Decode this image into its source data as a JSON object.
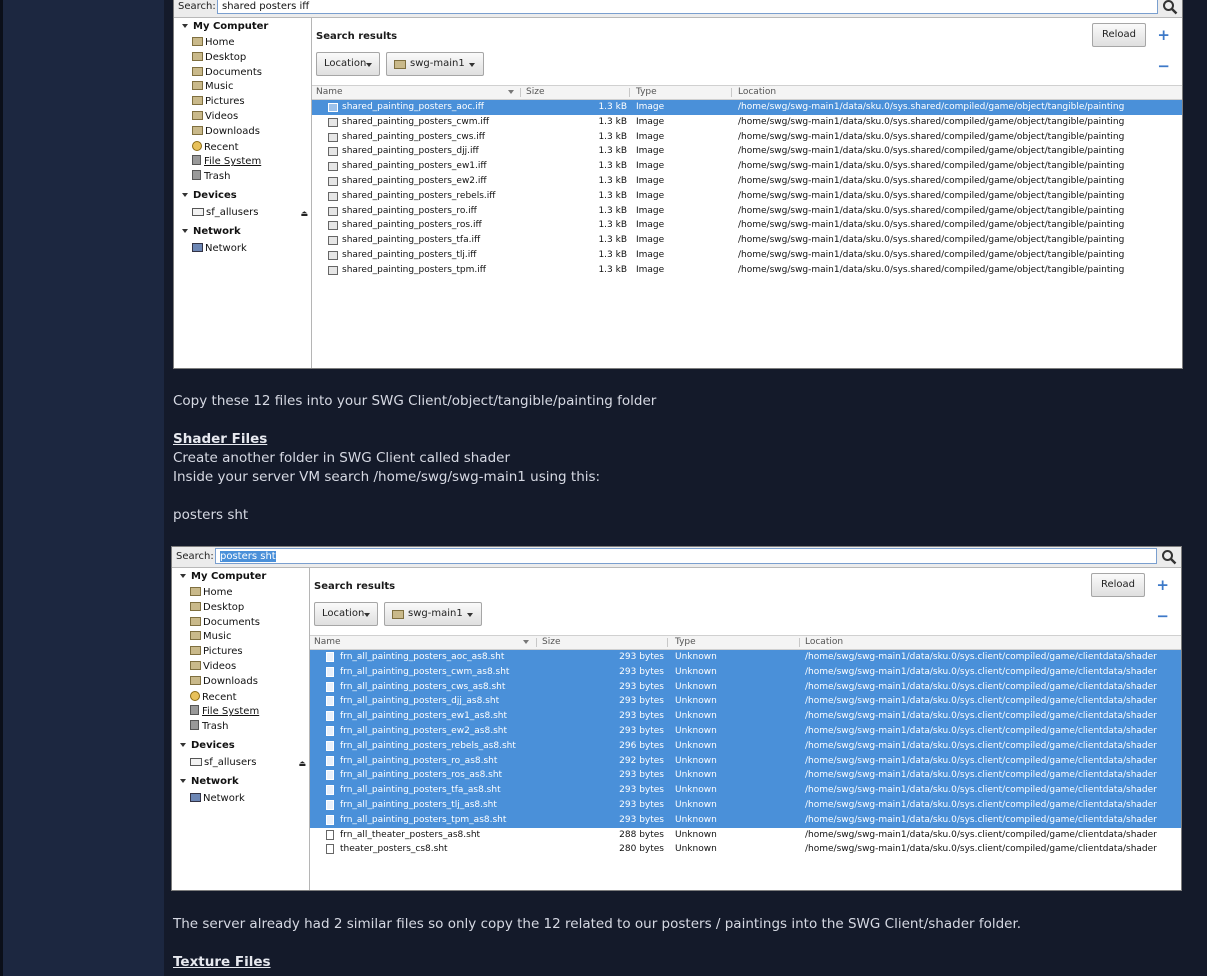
{
  "fm1": {
    "search_label": "Search:",
    "search_value": "shared posters iff",
    "places": {
      "my_computer": "My Computer",
      "items": [
        "Home",
        "Desktop",
        "Documents",
        "Music",
        "Pictures",
        "Videos",
        "Downloads",
        "Recent",
        "File System",
        "Trash"
      ],
      "devices": "Devices",
      "device_items": [
        "sf_allusers"
      ],
      "network": "Network",
      "network_items": [
        "Network"
      ]
    },
    "results_title": "Search results",
    "reload": "Reload",
    "location_btn": "Location",
    "folder_btn": "swg-main1",
    "columns": {
      "name": "Name",
      "size": "Size",
      "type": "Type",
      "location": "Location"
    },
    "rows": [
      {
        "name": "shared_painting_posters_aoc.iff",
        "size": "1.3 kB",
        "type": "Image",
        "location": "/home/swg/swg-main1/data/sku.0/sys.shared/compiled/game/object/tangible/painting",
        "selected": true
      },
      {
        "name": "shared_painting_posters_cwm.iff",
        "size": "1.3 kB",
        "type": "Image",
        "location": "/home/swg/swg-main1/data/sku.0/sys.shared/compiled/game/object/tangible/painting",
        "selected": false
      },
      {
        "name": "shared_painting_posters_cws.iff",
        "size": "1.3 kB",
        "type": "Image",
        "location": "/home/swg/swg-main1/data/sku.0/sys.shared/compiled/game/object/tangible/painting",
        "selected": false
      },
      {
        "name": "shared_painting_posters_djj.iff",
        "size": "1.3 kB",
        "type": "Image",
        "location": "/home/swg/swg-main1/data/sku.0/sys.shared/compiled/game/object/tangible/painting",
        "selected": false
      },
      {
        "name": "shared_painting_posters_ew1.iff",
        "size": "1.3 kB",
        "type": "Image",
        "location": "/home/swg/swg-main1/data/sku.0/sys.shared/compiled/game/object/tangible/painting",
        "selected": false
      },
      {
        "name": "shared_painting_posters_ew2.iff",
        "size": "1.3 kB",
        "type": "Image",
        "location": "/home/swg/swg-main1/data/sku.0/sys.shared/compiled/game/object/tangible/painting",
        "selected": false
      },
      {
        "name": "shared_painting_posters_rebels.iff",
        "size": "1.3 kB",
        "type": "Image",
        "location": "/home/swg/swg-main1/data/sku.0/sys.shared/compiled/game/object/tangible/painting",
        "selected": false
      },
      {
        "name": "shared_painting_posters_ro.iff",
        "size": "1.3 kB",
        "type": "Image",
        "location": "/home/swg/swg-main1/data/sku.0/sys.shared/compiled/game/object/tangible/painting",
        "selected": false
      },
      {
        "name": "shared_painting_posters_ros.iff",
        "size": "1.3 kB",
        "type": "Image",
        "location": "/home/swg/swg-main1/data/sku.0/sys.shared/compiled/game/object/tangible/painting",
        "selected": false
      },
      {
        "name": "shared_painting_posters_tfa.iff",
        "size": "1.3 kB",
        "type": "Image",
        "location": "/home/swg/swg-main1/data/sku.0/sys.shared/compiled/game/object/tangible/painting",
        "selected": false
      },
      {
        "name": "shared_painting_posters_tlj.iff",
        "size": "1.3 kB",
        "type": "Image",
        "location": "/home/swg/swg-main1/data/sku.0/sys.shared/compiled/game/object/tangible/painting",
        "selected": false
      },
      {
        "name": "shared_painting_posters_tpm.iff",
        "size": "1.3 kB",
        "type": "Image",
        "location": "/home/swg/swg-main1/data/sku.0/sys.shared/compiled/game/object/tangible/painting",
        "selected": false
      }
    ]
  },
  "fm2": {
    "search_label": "Search:",
    "search_value": "posters sht",
    "places": {
      "my_computer": "My Computer",
      "items": [
        "Home",
        "Desktop",
        "Documents",
        "Music",
        "Pictures",
        "Videos",
        "Downloads",
        "Recent",
        "File System",
        "Trash"
      ],
      "devices": "Devices",
      "device_items": [
        "sf_allusers"
      ],
      "network": "Network",
      "network_items": [
        "Network"
      ]
    },
    "results_title": "Search results",
    "reload": "Reload",
    "location_btn": "Location",
    "folder_btn": "swg-main1",
    "columns": {
      "name": "Name",
      "size": "Size",
      "type": "Type",
      "location": "Location"
    },
    "rows": [
      {
        "name": "frn_all_painting_posters_aoc_as8.sht",
        "size": "293 bytes",
        "type": "Unknown",
        "location": "/home/swg/swg-main1/data/sku.0/sys.client/compiled/game/clientdata/shader",
        "selected": true
      },
      {
        "name": "frn_all_painting_posters_cwm_as8.sht",
        "size": "293 bytes",
        "type": "Unknown",
        "location": "/home/swg/swg-main1/data/sku.0/sys.client/compiled/game/clientdata/shader",
        "selected": true
      },
      {
        "name": "frn_all_painting_posters_cws_as8.sht",
        "size": "293 bytes",
        "type": "Unknown",
        "location": "/home/swg/swg-main1/data/sku.0/sys.client/compiled/game/clientdata/shader",
        "selected": true
      },
      {
        "name": "frn_all_painting_posters_djj_as8.sht",
        "size": "293 bytes",
        "type": "Unknown",
        "location": "/home/swg/swg-main1/data/sku.0/sys.client/compiled/game/clientdata/shader",
        "selected": true
      },
      {
        "name": "frn_all_painting_posters_ew1_as8.sht",
        "size": "293 bytes",
        "type": "Unknown",
        "location": "/home/swg/swg-main1/data/sku.0/sys.client/compiled/game/clientdata/shader",
        "selected": true
      },
      {
        "name": "frn_all_painting_posters_ew2_as8.sht",
        "size": "293 bytes",
        "type": "Unknown",
        "location": "/home/swg/swg-main1/data/sku.0/sys.client/compiled/game/clientdata/shader",
        "selected": true
      },
      {
        "name": "frn_all_painting_posters_rebels_as8.sht",
        "size": "296 bytes",
        "type": "Unknown",
        "location": "/home/swg/swg-main1/data/sku.0/sys.client/compiled/game/clientdata/shader",
        "selected": true
      },
      {
        "name": "frn_all_painting_posters_ro_as8.sht",
        "size": "292 bytes",
        "type": "Unknown",
        "location": "/home/swg/swg-main1/data/sku.0/sys.client/compiled/game/clientdata/shader",
        "selected": true
      },
      {
        "name": "frn_all_painting_posters_ros_as8.sht",
        "size": "293 bytes",
        "type": "Unknown",
        "location": "/home/swg/swg-main1/data/sku.0/sys.client/compiled/game/clientdata/shader",
        "selected": true
      },
      {
        "name": "frn_all_painting_posters_tfa_as8.sht",
        "size": "293 bytes",
        "type": "Unknown",
        "location": "/home/swg/swg-main1/data/sku.0/sys.client/compiled/game/clientdata/shader",
        "selected": true
      },
      {
        "name": "frn_all_painting_posters_tlj_as8.sht",
        "size": "293 bytes",
        "type": "Unknown",
        "location": "/home/swg/swg-main1/data/sku.0/sys.client/compiled/game/clientdata/shader",
        "selected": true
      },
      {
        "name": "frn_all_painting_posters_tpm_as8.sht",
        "size": "293 bytes",
        "type": "Unknown",
        "location": "/home/swg/swg-main1/data/sku.0/sys.client/compiled/game/clientdata/shader",
        "selected": true
      },
      {
        "name": "frn_all_theater_posters_as8.sht",
        "size": "288 bytes",
        "type": "Unknown",
        "location": "/home/swg/swg-main1/data/sku.0/sys.client/compiled/game/clientdata/shader",
        "selected": false
      },
      {
        "name": "theater_posters_cs8.sht",
        "size": "280 bytes",
        "type": "Unknown",
        "location": "/home/swg/swg-main1/data/sku.0/sys.client/compiled/game/clientdata/shader",
        "selected": false
      }
    ]
  },
  "article": {
    "p1": "Copy these 12 files into your SWG Client/object/tangible/painting folder",
    "h_shader": "Shader Files",
    "p2": "Create another folder in SWG Client called shader",
    "p3": "Inside your server VM search /home/swg/swg-main1 using this:",
    "p4": "posters sht",
    "p5": "The server already had 2 similar files so only copy the 12 related to our posters / paintings into the SWG Client/shader folder.",
    "h_texture": "Texture Files"
  }
}
